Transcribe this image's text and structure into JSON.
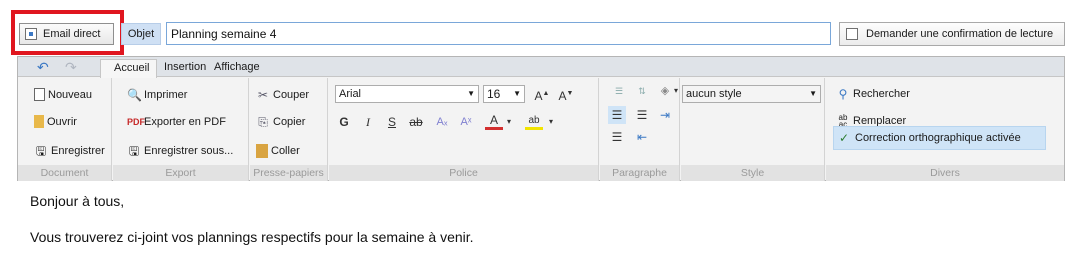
{
  "header": {
    "email_direct_label": "Email direct",
    "objet_label": "Objet",
    "objet_value": "Planning semaine 4",
    "confirm_label": "Demander une confirmation de lecture",
    "highlight_color": "#e0161f"
  },
  "ribbon": {
    "tabs": [
      {
        "label": "Accueil",
        "active": true
      },
      {
        "label": "Insertion",
        "active": false
      },
      {
        "label": "Affichage",
        "active": false
      }
    ],
    "document": {
      "label": "Document",
      "items": [
        "Nouveau",
        "Ouvrir",
        "Enregistrer"
      ]
    },
    "export": {
      "label": "Export",
      "items": [
        "Imprimer",
        "Exporter en PDF",
        "Enregistrer sous..."
      ]
    },
    "clipboard": {
      "label": "Presse-papiers",
      "items": [
        "Couper",
        "Copier",
        "Coller"
      ]
    },
    "font": {
      "label": "Police",
      "family": "Arial",
      "size": "16",
      "buttons": [
        "G",
        "I",
        "S",
        "ab",
        "Aₓ",
        "Aˣ",
        "A"
      ]
    },
    "paragraph": {
      "label": "Paragraphe"
    },
    "style": {
      "label": "Style",
      "value": "aucun style"
    },
    "divers": {
      "label": "Divers",
      "items": [
        "Rechercher",
        "Remplacer",
        "Correction orthographique activée"
      ]
    }
  },
  "body": {
    "lines": [
      "Bonjour à tous,",
      "Vous trouverez ci-joint vos plannings respectifs pour la semaine à venir."
    ]
  }
}
